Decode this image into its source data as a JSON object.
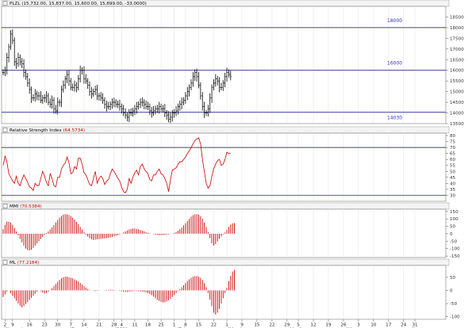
{
  "colors": {
    "price_bar": "#000000",
    "rsi_line": "#cc0000",
    "osc_bar": "#cc0000",
    "ref_line": "#000080",
    "level_label": "#3030c0",
    "grid": "#d9d9e6",
    "title_value": "#c00000"
  },
  "chart_data": [
    {
      "type": "ohlc",
      "title_symbol": "PLZL",
      "title_values": "(15,732.00, 15,837.00, 15,600.00, 15,699.00, -33.0000)",
      "ylim": [
        13500,
        19000
      ],
      "yticks": [
        "18500",
        "18000",
        "17500",
        "17000",
        "16500",
        "16000",
        "15500",
        "15000",
        "14500",
        "14000",
        "13500"
      ],
      "levels": [
        {
          "value": 18000,
          "label": "18000"
        },
        {
          "value": 16000,
          "label": "16000"
        },
        {
          "value": 14030,
          "label": "14030"
        }
      ],
      "closes": [
        15900,
        16000,
        16600,
        17100,
        17700,
        17400,
        16400,
        16300,
        16600,
        16400,
        16300,
        15900,
        15700,
        15400,
        15100,
        14700,
        14700,
        14900,
        14800,
        14800,
        14600,
        14700,
        14700,
        14800,
        14500,
        14400,
        14600,
        14200,
        14100,
        14500,
        14500,
        15100,
        15300,
        15600,
        15800,
        15500,
        15200,
        15200,
        15300,
        15200,
        15600,
        16000,
        16000,
        15600,
        15500,
        15300,
        15000,
        14900,
        15000,
        15100,
        14800,
        14800,
        14700,
        14600,
        14400,
        14300,
        14300,
        14400,
        14500,
        14500,
        14400,
        14400,
        14300,
        14200,
        14000,
        13900,
        13800,
        14000,
        14000,
        14100,
        14200,
        14300,
        14400,
        14500,
        14500,
        14400,
        14300,
        14300,
        14100,
        14000,
        14100,
        14200,
        14200,
        14300,
        14200,
        14200,
        14000,
        13900,
        13700,
        13800,
        14000,
        14000,
        14100,
        14300,
        14400,
        14500,
        14600,
        14800,
        15000,
        15200,
        15400,
        15700,
        15900,
        15700,
        15300,
        14800,
        14300,
        14000,
        14000,
        14200,
        14700,
        15200,
        15400,
        15600,
        15500,
        15200,
        15200,
        15400,
        15700,
        15900,
        15800,
        15700
      ]
    },
    {
      "type": "line",
      "title_name": "Relative Strength Index",
      "title_value": "(64.5734)",
      "ylim": [
        25,
        82
      ],
      "yticks": [
        "80",
        "75",
        "70",
        "65",
        "60",
        "55",
        "50",
        "45",
        "40",
        "35",
        "30"
      ],
      "levels": [
        70,
        30
      ],
      "values": [
        55,
        63,
        58,
        48,
        45,
        42,
        40,
        46,
        40,
        38,
        43,
        47,
        44,
        41,
        37,
        36,
        34,
        40,
        38,
        38,
        44,
        50,
        46,
        41,
        38,
        48,
        44,
        38,
        37,
        45,
        45,
        52,
        55,
        57,
        62,
        57,
        48,
        49,
        54,
        52,
        61,
        61,
        56,
        49,
        47,
        43,
        39,
        38,
        44,
        50,
        40,
        44,
        46,
        44,
        39,
        42,
        43,
        48,
        52,
        50,
        47,
        44,
        42,
        37,
        33,
        32,
        35,
        44,
        40,
        45,
        49,
        51,
        47,
        54,
        56,
        52,
        50,
        48,
        43,
        42,
        47,
        47,
        50,
        52,
        48,
        47,
        44,
        40,
        33,
        43,
        51,
        52,
        53,
        56,
        58,
        58,
        60,
        62,
        65,
        67,
        70,
        73,
        76,
        77,
        78,
        73,
        60,
        50,
        40,
        36,
        38,
        46,
        52,
        56,
        59,
        60,
        55,
        56,
        60,
        66,
        65,
        65
      ]
    },
    {
      "type": "bar",
      "title_name": "MMI",
      "title_value": "(70.5384)",
      "ylim": [
        -160,
        165
      ],
      "yticks": [
        "150",
        "100",
        "50",
        "0",
        "-50",
        "-100",
        "-150"
      ],
      "values": [
        30,
        60,
        82,
        80,
        75,
        60,
        38,
        15,
        -10,
        -35,
        -58,
        -80,
        -100,
        -110,
        -112,
        -108,
        -95,
        -80,
        -65,
        -50,
        -36,
        -22,
        -8,
        5,
        15,
        28,
        42,
        58,
        75,
        92,
        108,
        120,
        128,
        132,
        130,
        126,
        118,
        108,
        95,
        80,
        64,
        46,
        28,
        10,
        -5,
        -18,
        -30,
        -38,
        -42,
        -40,
        -38,
        -36,
        -35,
        -33,
        -32,
        -30,
        -28,
        -25,
        -22,
        -18,
        -14,
        -10,
        -5,
        0,
        8,
        15,
        22,
        28,
        32,
        35,
        35,
        32,
        30,
        25,
        20,
        15,
        10,
        6,
        3,
        0,
        -3,
        -6,
        -8,
        -10,
        -10,
        -9,
        -8,
        -6,
        -4,
        -2,
        0,
        5,
        12,
        20,
        30,
        42,
        56,
        70,
        85,
        100,
        115,
        125,
        130,
        132,
        128,
        118,
        100,
        75,
        45,
        10,
        -30,
        -65,
        -80,
        -70,
        -52,
        -35,
        -18,
        -5,
        8,
        25,
        45,
        62,
        70,
        72
      ]
    },
    {
      "type": "bar",
      "title_name": "ML",
      "title_value": "(77.2184)",
      "ylim": [
        -110,
        95
      ],
      "yticks": [
        "50",
        "0",
        "-50",
        "-100"
      ],
      "values": [
        -25,
        -15,
        -5,
        0,
        -10,
        -20,
        -30,
        -40,
        -50,
        -58,
        -65,
        -60,
        -52,
        -45,
        -36,
        -28,
        -20,
        -12,
        -5,
        0,
        -3,
        -8,
        -12,
        -10,
        -5,
        0,
        8,
        16,
        24,
        32,
        40,
        46,
        50,
        52,
        52,
        50,
        48,
        46,
        42,
        38,
        34,
        28,
        22,
        16,
        10,
        5,
        2,
        0,
        -2,
        -3,
        -2,
        -1,
        0,
        0,
        1,
        2,
        2,
        3,
        2,
        2,
        1,
        0,
        -2,
        -3,
        -5,
        -6,
        -6,
        -5,
        -4,
        -3,
        -2,
        -2,
        -3,
        -4,
        -5,
        -6,
        -8,
        -10,
        -14,
        -18,
        -24,
        -30,
        -36,
        -40,
        -44,
        -46,
        -45,
        -42,
        -38,
        -32,
        -25,
        -18,
        -10,
        -2,
        5,
        12,
        20,
        28,
        36,
        42,
        48,
        52,
        54,
        55,
        52,
        48,
        40,
        28,
        12,
        -10,
        -35,
        -60,
        -85,
        -92,
        -85,
        -70,
        -50,
        -30,
        -10,
        10,
        35,
        55,
        72,
        78
      ]
    }
  ],
  "x_axis": {
    "day_labels": [
      {
        "i": 1,
        "text": "2"
      },
      {
        "i": 5,
        "text": "9"
      },
      {
        "i": 14,
        "text": "16"
      },
      {
        "i": 22,
        "text": "23"
      },
      {
        "i": 29,
        "text": "30"
      },
      {
        "i": 36,
        "text": "7"
      },
      {
        "i": 43,
        "text": "14"
      },
      {
        "i": 51,
        "text": "21"
      },
      {
        "i": 59,
        "text": "28"
      },
      {
        "i": 63,
        "text": "4"
      },
      {
        "i": 70,
        "text": "11"
      },
      {
        "i": 77,
        "text": "18"
      },
      {
        "i": 84,
        "text": "25"
      },
      {
        "i": 91,
        "text": "1"
      },
      {
        "i": 97,
        "text": "8"
      },
      {
        "i": 104,
        "text": "15"
      },
      {
        "i": 112,
        "text": "22"
      },
      {
        "i": 119,
        "text": "1"
      },
      {
        "i": 127,
        "text": "9"
      },
      {
        "i": 135,
        "text": "15"
      },
      {
        "i": 143,
        "text": "22"
      },
      {
        "i": 151,
        "text": "29"
      },
      {
        "i": 157,
        "text": "5"
      },
      {
        "i": 165,
        "text": "12"
      },
      {
        "i": 173,
        "text": "19"
      },
      {
        "i": 181,
        "text": "26"
      },
      {
        "i": 189,
        "text": "3"
      },
      {
        "i": 197,
        "text": "10"
      },
      {
        "i": 205,
        "text": "17"
      },
      {
        "i": 213,
        "text": "24"
      },
      {
        "i": 219,
        "text": "31"
      }
    ],
    "month_labels": [
      {
        "i": 1,
        "text": "November"
      },
      {
        "i": 36,
        "text": "December"
      },
      {
        "i": 60,
        "text": "2021"
      },
      {
        "i": 93,
        "text": "February"
      },
      {
        "i": 120,
        "text": "March"
      },
      {
        "i": 153,
        "text": "April"
      },
      {
        "i": 183,
        "text": "May"
      },
      {
        "i": 218,
        "text": "June"
      }
    ]
  }
}
